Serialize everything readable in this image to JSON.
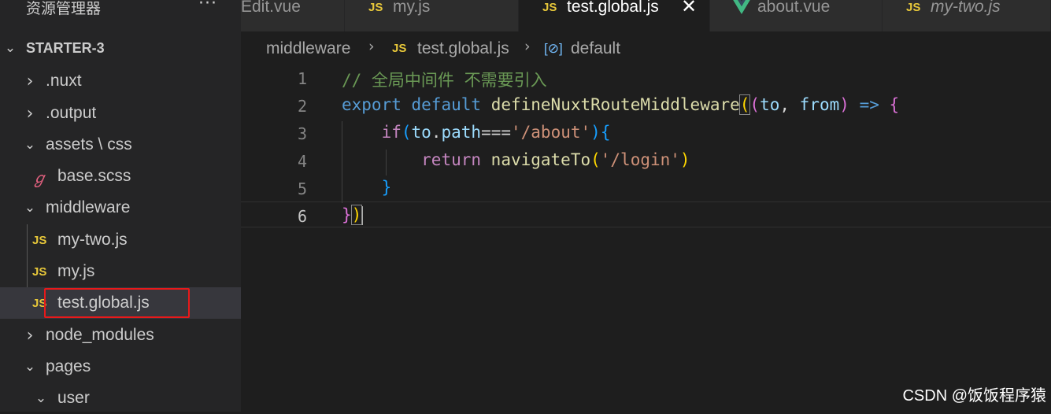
{
  "sidebar": {
    "title": "资源管理器",
    "more": "···",
    "root": "STARTER-3",
    "items": [
      {
        "label": ".nuxt"
      },
      {
        "label": ".output"
      },
      {
        "label": "assets \\ css"
      },
      {
        "label": "base.scss"
      },
      {
        "label": "middleware"
      },
      {
        "label": "my-two.js"
      },
      {
        "label": "my.js"
      },
      {
        "label": "test.global.js"
      },
      {
        "label": "node_modules"
      },
      {
        "label": "pages"
      },
      {
        "label": "user"
      }
    ]
  },
  "icons": {
    "js": "JS",
    "sass": "sass-icon",
    "vue": "vue-icon",
    "chevron_right": "›",
    "chevron_down": "⌄"
  },
  "tabs": [
    {
      "label": "Edit.vue"
    },
    {
      "label": "my.js"
    },
    {
      "label": "test.global.js",
      "close": "✕"
    },
    {
      "label": "about.vue"
    },
    {
      "label": "my-two.js"
    }
  ],
  "breadcrumb": {
    "folder": "middleware",
    "file": "test.global.js",
    "symbol": "default",
    "symbol_icon": "[⊘]"
  },
  "editor": {
    "line_numbers": [
      "1",
      "2",
      "3",
      "4",
      "5",
      "6"
    ],
    "line1_comment": "// 全局中间件 不需要引入",
    "line2": {
      "kw1": "export",
      "kw2": "default",
      "fn": "defineNuxtRouteMiddleware",
      "p1": "to",
      "p2": "from",
      "arrow": "=>"
    },
    "line3": {
      "kw": "if",
      "obj": "to",
      "prop": "path",
      "op": "===",
      "str": "'/about'"
    },
    "line4": {
      "kw": "return",
      "fn": "navigateTo",
      "str": "'/login'"
    }
  },
  "watermark": "CSDN @饭饭程序猿",
  "colors": {
    "accent_js": "#e8c83a",
    "highlight_box": "#e8191a",
    "vue": "#41b883"
  }
}
